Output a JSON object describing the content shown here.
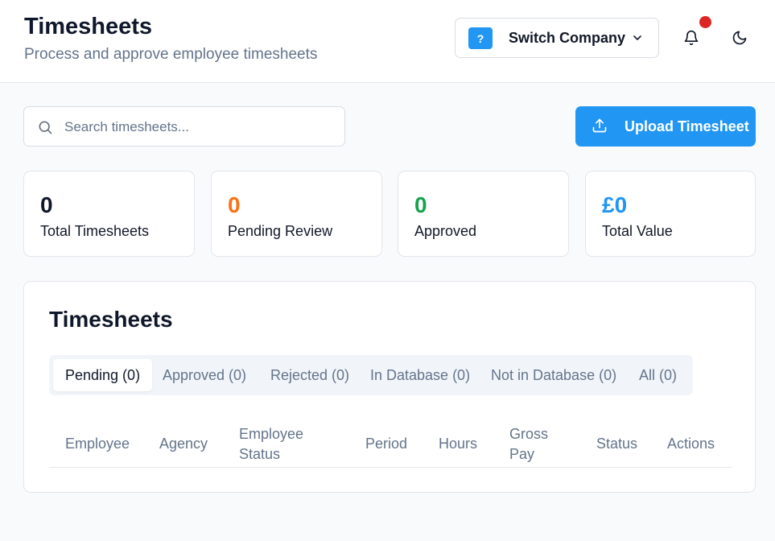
{
  "header": {
    "title": "Timesheets",
    "subtitle": "Process and approve employee timesheets",
    "company_badge": "?",
    "switch_company_label": "Switch Company"
  },
  "icons": {
    "search": "search-icon",
    "upload": "upload-icon",
    "bell": "bell-icon",
    "moon": "moon-icon",
    "chevron": "chevron-down-icon"
  },
  "colors": {
    "accent": "#2196f3",
    "pending": "#f97316",
    "approved": "#16a34a",
    "total_value": "#2196f3",
    "notification": "#dc2626"
  },
  "search": {
    "placeholder": "Search timesheets...",
    "value": ""
  },
  "actions": {
    "upload_label": "Upload Timesheet"
  },
  "stats": [
    {
      "value": "0",
      "label": "Total Timesheets"
    },
    {
      "value": "0",
      "label": "Pending Review"
    },
    {
      "value": "0",
      "label": "Approved"
    },
    {
      "value": "£0",
      "label": "Total Value"
    }
  ],
  "table_card": {
    "title": "Timesheets",
    "tabs": [
      {
        "label": "Pending (0)",
        "active": true
      },
      {
        "label": "Approved (0)",
        "active": false
      },
      {
        "label": "Rejected (0)",
        "active": false
      },
      {
        "label": "In Database (0)",
        "active": false
      },
      {
        "label": "Not in Database (0)",
        "active": false
      },
      {
        "label": "All (0)",
        "active": false
      }
    ],
    "columns": {
      "employee": "Employee",
      "agency": "Agency",
      "employee_status_1": "Employee",
      "employee_status_2": "Status",
      "period": "Period",
      "hours": "Hours",
      "gross_pay_1": "Gross",
      "gross_pay_2": "Pay",
      "status": "Status",
      "actions": "Actions"
    }
  }
}
